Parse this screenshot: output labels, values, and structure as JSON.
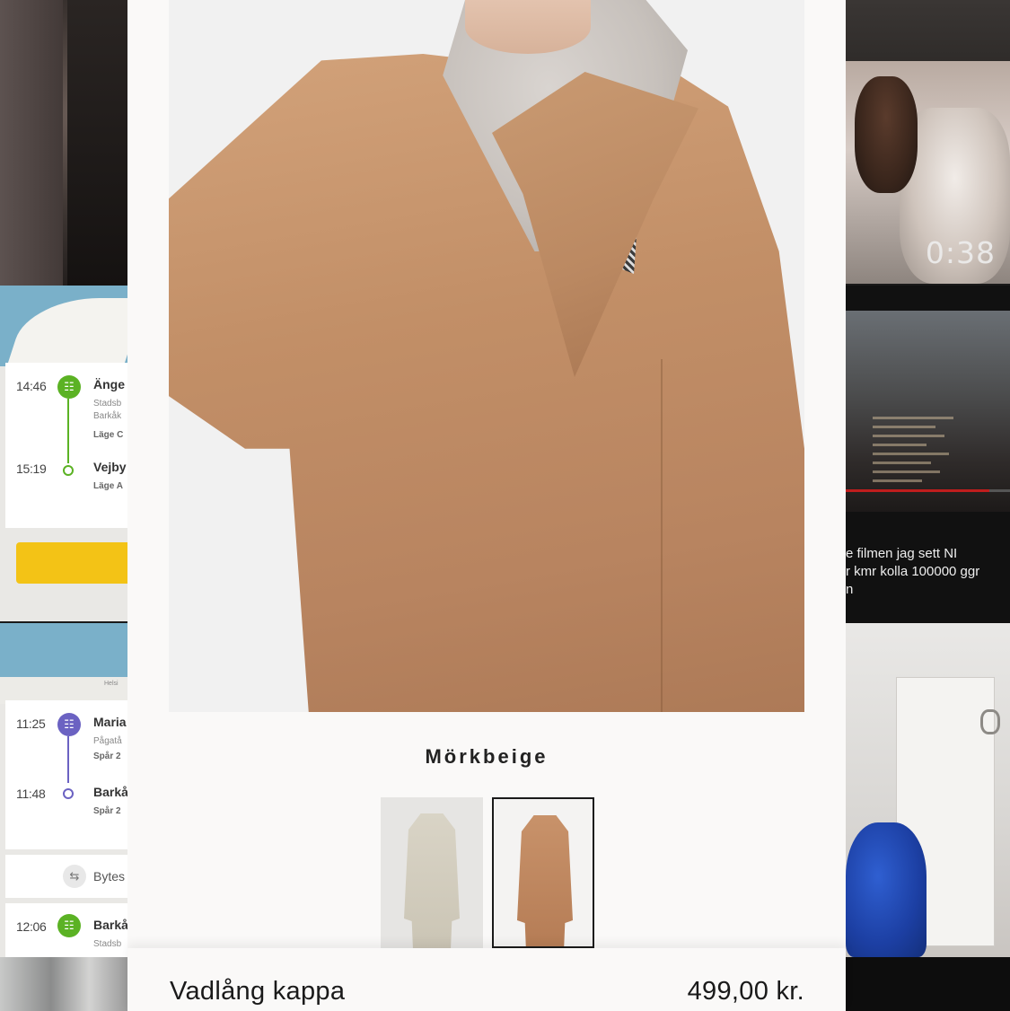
{
  "product": {
    "color_name": "Mörkbeige",
    "name": "Vadlång kappa",
    "price": "499,00 kr.",
    "swatches": [
      {
        "color": "#d6d1c3",
        "selected": false
      },
      {
        "color": "#bf8760",
        "selected": true
      }
    ]
  },
  "background": {
    "transit_top": {
      "rows": [
        {
          "time": "14:46",
          "stop": "Änge",
          "sub1": "Stadsb",
          "sub2": "Barkåk",
          "sub3": "Läge C"
        },
        {
          "time": "15:19",
          "stop": "Vejby",
          "sub1": "Läge A"
        }
      ],
      "line_color": "#5bb224"
    },
    "transit_bottom": {
      "map_label": "Helsi",
      "rows": [
        {
          "time": "11:25",
          "stop": "Maria",
          "sub1": "Pågatå",
          "sub2": "Spår 2"
        },
        {
          "time": "11:48",
          "stop": "Barkå",
          "sub1": "Spår 2"
        },
        {
          "stop": "Bytes"
        },
        {
          "time": "12:06",
          "stop": "Barkå",
          "sub1": "Stadsb"
        }
      ],
      "line_color": "#6b62c2"
    },
    "video_duration": "0:38",
    "video_caption_lines": [
      "e filmen jag sett NI",
      "r kmr kolla 100000 ggr",
      "n"
    ]
  }
}
